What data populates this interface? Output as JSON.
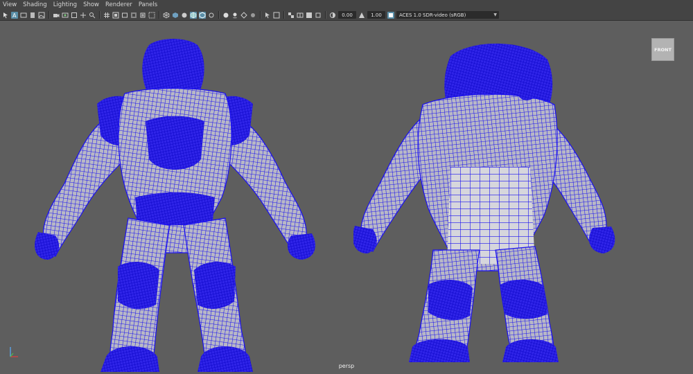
{
  "menu": [
    "View",
    "Shading",
    "Lighting",
    "Show",
    "Renderer",
    "Panels"
  ],
  "toolbar": {
    "exposure_value": "0.00",
    "gamma_value": "1.00",
    "colorspace_value": "ACES 1.0 SDR-video (sRGB)"
  },
  "viewport": {
    "camera": "persp",
    "viewcube_face": "FRONT",
    "wireframe_color": "#1a10f0",
    "surface_color": "#b9b9c4"
  }
}
